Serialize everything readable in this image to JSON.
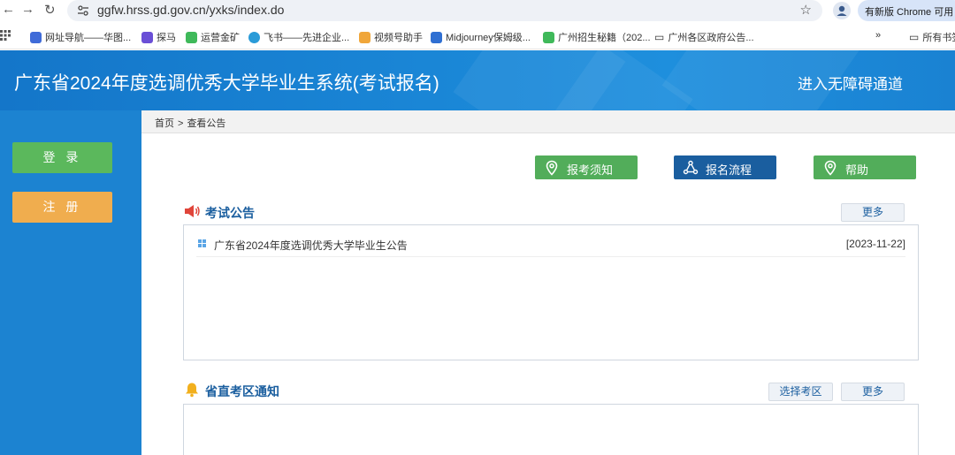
{
  "browser": {
    "url": "ggfw.hrss.gd.gov.cn/yxks/index.do",
    "update_label": "有新版 Chrome 可用",
    "bookmarks": [
      "网址导航——华图...",
      "探马",
      "运营金矿",
      "飞书——先进企业...",
      "视频号助手",
      "Midjourney保姆级...",
      "广州招生秘籍（202...",
      "广州各区政府公告...",
      "所有书签"
    ]
  },
  "header": {
    "title": "广东省2024年度选调优秀大学毕业生系统(考试报名)",
    "accessibility_link": "进入无障碍通道"
  },
  "sidebar": {
    "login": "登 录",
    "register": "注 册"
  },
  "breadcrumb": {
    "home": "首页",
    "separator": ">",
    "current": "查看公告"
  },
  "actions": [
    {
      "label": "报考须知"
    },
    {
      "label": "报名流程"
    },
    {
      "label": "帮助"
    }
  ],
  "exam_notice": {
    "title": "考试公告",
    "more": "更多",
    "items": [
      {
        "title": "广东省2024年度选调优秀大学毕业生公告",
        "date": "[2023-11-22]"
      }
    ]
  },
  "district_notice": {
    "title": "省直考区通知",
    "select": "选择考区",
    "more": "更多"
  },
  "colors": {
    "header_blue": "#1a82d2",
    "sidebar_blue": "#1c83d1",
    "green": "#52ad5a",
    "orange": "#f0ad4e",
    "dark_blue": "#1a5e9f"
  }
}
